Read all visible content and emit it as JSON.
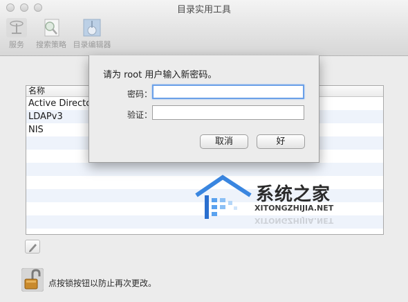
{
  "window": {
    "title": "目录实用工具"
  },
  "toolbar": {
    "items": [
      {
        "label": "服务",
        "icon": "services-icon"
      },
      {
        "label": "搜索策略",
        "icon": "search-policy-icon"
      },
      {
        "label": "目录编辑器",
        "icon": "directory-editor-icon"
      }
    ]
  },
  "list": {
    "header": "名称",
    "rows": [
      "Active Directory",
      "LDAPv3",
      "NIS",
      "",
      "",
      "",
      "",
      "",
      "",
      ""
    ]
  },
  "lock": {
    "text": "点按锁按钮以防止再次更改。",
    "icon": "lock-open-icon"
  },
  "dialog": {
    "prompt": "请为 root 用户输入新密码。",
    "password_label": "密码：",
    "verify_label": "验证：",
    "password_value": "",
    "verify_value": "",
    "cancel_label": "取消",
    "ok_label": "好"
  },
  "watermark": {
    "title": "系统之家",
    "url": "XITONGZHIJIA.NET"
  },
  "colors": {
    "focus_ring": "#6aa0e8",
    "row_stripe": "#eef3fb",
    "watermark_blue": "#2a6fcf"
  }
}
